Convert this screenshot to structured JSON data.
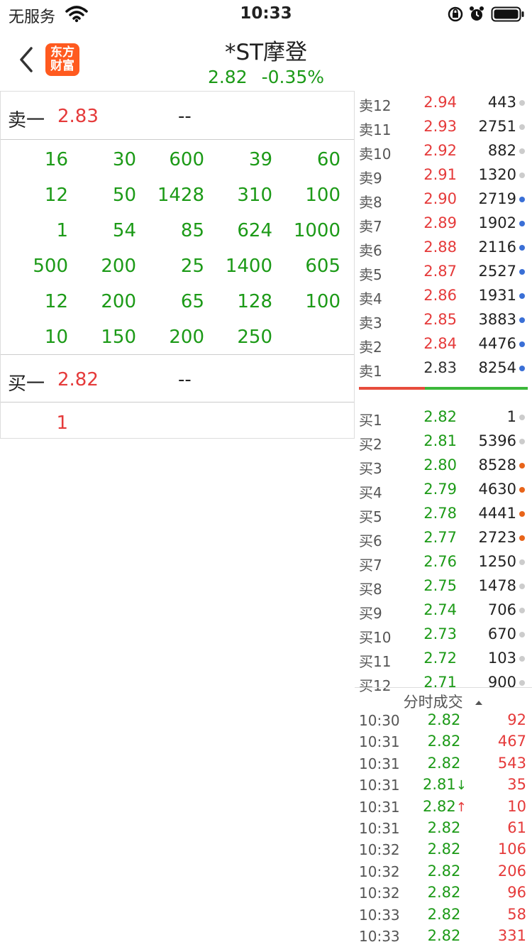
{
  "status_bar": {
    "carrier": "无服务",
    "time": "10:33"
  },
  "header": {
    "logo_line1": "东方",
    "logo_line2": "财富",
    "stock_name": "*ST摩登",
    "price": "2.82",
    "change_pct": "-0.35%"
  },
  "colors": {
    "up": "#e53a3a",
    "down": "#1c9a17",
    "accent": "#ff5a1f",
    "dot_blue": "#3a6fd6",
    "dot_orange": "#e8641a",
    "dot_gray": "#cccccc"
  },
  "level2": {
    "sell1": {
      "label": "卖一",
      "price": "2.83",
      "value": "--"
    },
    "sell_queue": [
      [
        "16",
        "30",
        "600",
        "39",
        "60"
      ],
      [
        "12",
        "50",
        "1428",
        "310",
        "100"
      ],
      [
        "1",
        "54",
        "85",
        "624",
        "1000"
      ],
      [
        "500",
        "200",
        "25",
        "1400",
        "605"
      ],
      [
        "12",
        "200",
        "65",
        "128",
        "100"
      ],
      [
        "10",
        "150",
        "200",
        "250",
        ""
      ]
    ],
    "buy1": {
      "label": "买一",
      "price": "2.82",
      "value": "--"
    },
    "buy_queue": [
      [
        "1",
        "",
        "",
        "",
        ""
      ]
    ]
  },
  "order_book": {
    "asks": [
      {
        "label": "卖12",
        "price": "2.94",
        "volume": "443",
        "dot": "gray",
        "price_color": "red"
      },
      {
        "label": "卖11",
        "price": "2.93",
        "volume": "2751",
        "dot": "gray",
        "price_color": "red"
      },
      {
        "label": "卖10",
        "price": "2.92",
        "volume": "882",
        "dot": "gray",
        "price_color": "red"
      },
      {
        "label": "卖9",
        "price": "2.91",
        "volume": "1320",
        "dot": "gray",
        "price_color": "red"
      },
      {
        "label": "卖8",
        "price": "2.90",
        "volume": "2719",
        "dot": "blue",
        "price_color": "red"
      },
      {
        "label": "卖7",
        "price": "2.89",
        "volume": "1902",
        "dot": "blue",
        "price_color": "red"
      },
      {
        "label": "卖6",
        "price": "2.88",
        "volume": "2116",
        "dot": "blue",
        "price_color": "red"
      },
      {
        "label": "卖5",
        "price": "2.87",
        "volume": "2527",
        "dot": "blue",
        "price_color": "red"
      },
      {
        "label": "卖4",
        "price": "2.86",
        "volume": "1931",
        "dot": "blue",
        "price_color": "red"
      },
      {
        "label": "卖3",
        "price": "2.85",
        "volume": "3883",
        "dot": "blue",
        "price_color": "red"
      },
      {
        "label": "卖2",
        "price": "2.84",
        "volume": "4476",
        "dot": "blue",
        "price_color": "red"
      },
      {
        "label": "卖1",
        "price": "2.83",
        "volume": "8254",
        "dot": "blue",
        "price_color": "dark"
      }
    ],
    "sell_ratio": 0.39,
    "bids": [
      {
        "label": "买1",
        "price": "2.82",
        "volume": "1",
        "dot": "gray"
      },
      {
        "label": "买2",
        "price": "2.81",
        "volume": "5396",
        "dot": "gray"
      },
      {
        "label": "买3",
        "price": "2.80",
        "volume": "8528",
        "dot": "orange"
      },
      {
        "label": "买4",
        "price": "2.79",
        "volume": "4630",
        "dot": "orange"
      },
      {
        "label": "买5",
        "price": "2.78",
        "volume": "4441",
        "dot": "orange"
      },
      {
        "label": "买6",
        "price": "2.77",
        "volume": "2723",
        "dot": "orange"
      },
      {
        "label": "买7",
        "price": "2.76",
        "volume": "1250",
        "dot": "gray"
      },
      {
        "label": "买8",
        "price": "2.75",
        "volume": "1478",
        "dot": "gray"
      },
      {
        "label": "买9",
        "price": "2.74",
        "volume": "706",
        "dot": "gray"
      },
      {
        "label": "买10",
        "price": "2.73",
        "volume": "670",
        "dot": "gray"
      },
      {
        "label": "买11",
        "price": "2.72",
        "volume": "103",
        "dot": "gray"
      },
      {
        "label": "买12",
        "price": "2.71",
        "volume": "900",
        "dot": "gray"
      }
    ]
  },
  "ticks": {
    "title": "分时成交",
    "rows": [
      {
        "time": "10:30",
        "price": "2.82",
        "arrow": "",
        "volume": "92"
      },
      {
        "time": "10:31",
        "price": "2.82",
        "arrow": "",
        "volume": "467"
      },
      {
        "time": "10:31",
        "price": "2.82",
        "arrow": "",
        "volume": "543"
      },
      {
        "time": "10:31",
        "price": "2.81",
        "arrow": "↓",
        "volume": "35"
      },
      {
        "time": "10:31",
        "price": "2.82",
        "arrow": "↑",
        "volume": "10"
      },
      {
        "time": "10:31",
        "price": "2.82",
        "arrow": "",
        "volume": "61"
      },
      {
        "time": "10:32",
        "price": "2.82",
        "arrow": "",
        "volume": "106"
      },
      {
        "time": "10:32",
        "price": "2.82",
        "arrow": "",
        "volume": "206"
      },
      {
        "time": "10:32",
        "price": "2.82",
        "arrow": "",
        "volume": "96"
      },
      {
        "time": "10:33",
        "price": "2.82",
        "arrow": "",
        "volume": "58"
      },
      {
        "time": "10:33",
        "price": "2.82",
        "arrow": "",
        "volume": "331"
      }
    ]
  }
}
